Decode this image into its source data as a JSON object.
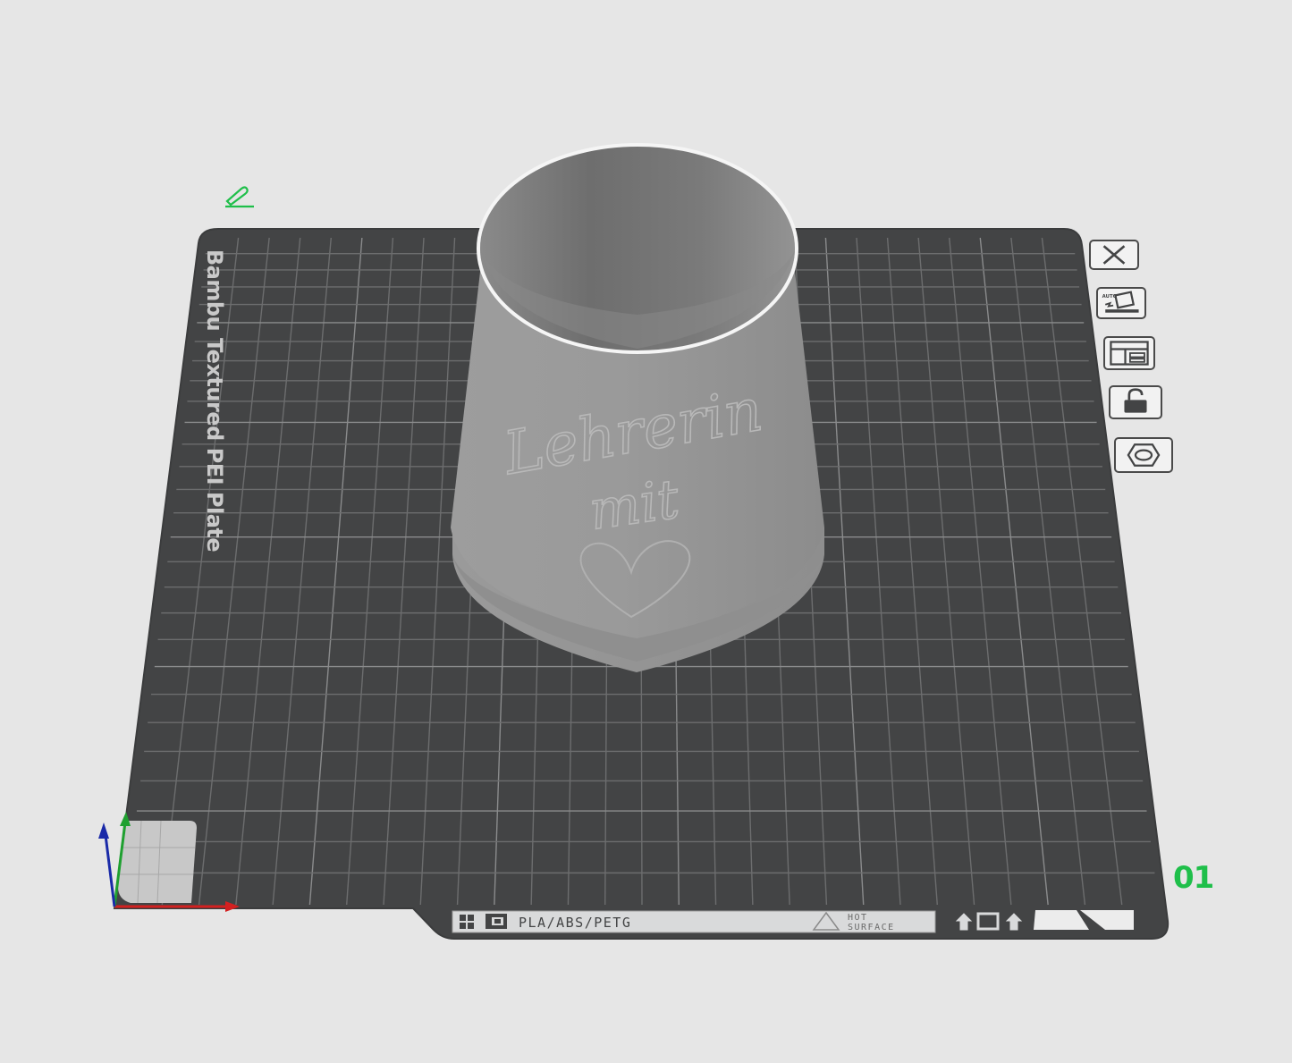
{
  "plate": {
    "name_label": "Bambu Textured PEI Plate",
    "index": "01",
    "material_label": "PLA/ABS/PETG",
    "warning_line1": "HOT",
    "warning_line2": "SURFACE"
  },
  "model": {
    "engraving_line1": "Lehrerin",
    "engraving_line2": "mit"
  },
  "plate_tools": [
    {
      "name": "remove-plate-button",
      "icon": "close-icon"
    },
    {
      "name": "auto-orient-button",
      "icon": "auto-orient-icon",
      "badge": "AUTO"
    },
    {
      "name": "arrange-button",
      "icon": "arrange-icon"
    },
    {
      "name": "lock-plate-button",
      "icon": "unlock-icon"
    },
    {
      "name": "plate-settings-button",
      "icon": "hexagon-nut-icon"
    }
  ],
  "colors": {
    "background": "#e6e6e6",
    "plate": "#434445",
    "grid": "#6a6b6c",
    "model": "#9a9a9a",
    "accent": "#1fbf4a",
    "axis_x": "#d42020",
    "axis_y": "#1fa030",
    "axis_z": "#1a2aa8"
  }
}
